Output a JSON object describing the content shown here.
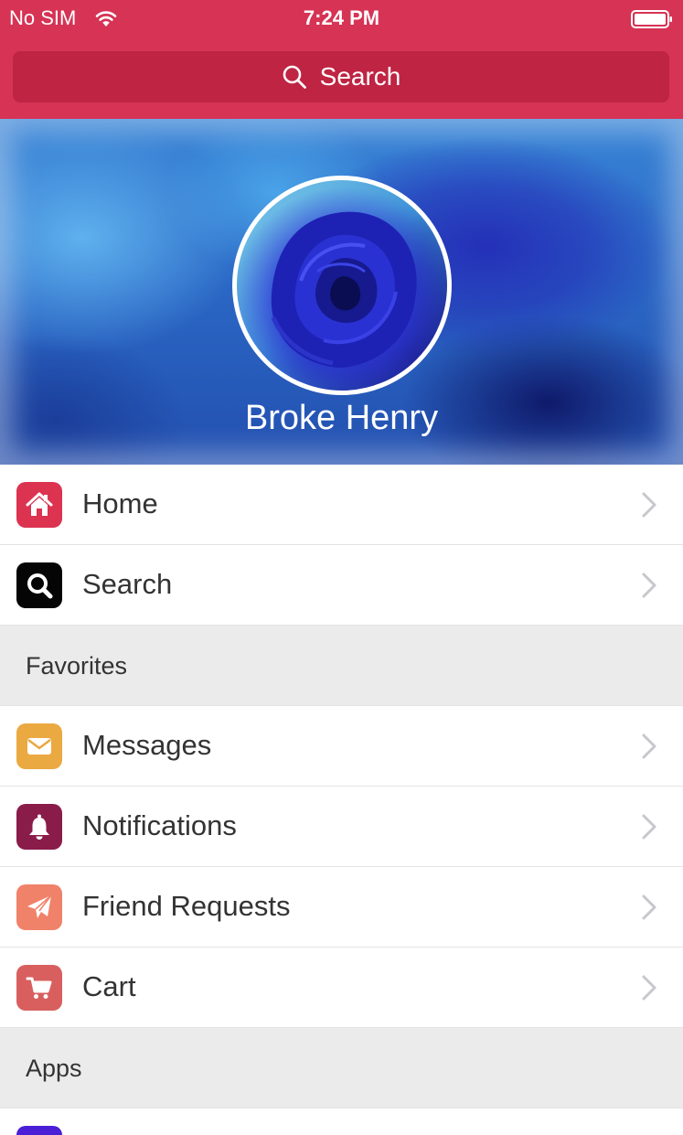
{
  "status_bar": {
    "carrier": "No SIM",
    "time": "7:24 PM"
  },
  "search": {
    "label": "Search"
  },
  "profile": {
    "name": "Broke Henry"
  },
  "menu": {
    "home": {
      "label": "Home",
      "icon": "home-icon",
      "color": "#dc3350"
    },
    "search": {
      "label": "Search",
      "icon": "search-icon",
      "color": "#050505"
    },
    "favorites_header": "Favorites",
    "messages": {
      "label": "Messages",
      "icon": "envelope-icon",
      "color": "#eba941"
    },
    "notifications": {
      "label": "Notifications",
      "icon": "bell-icon",
      "color": "#8a1c4a"
    },
    "friend_requests": {
      "label": "Friend Requests",
      "icon": "paper-plane-icon",
      "color": "#f0826a"
    },
    "cart": {
      "label": "Cart",
      "icon": "cart-icon",
      "color": "#d95f5f"
    },
    "apps_header": "Apps"
  },
  "colors": {
    "accent": "#d63355",
    "search_bar": "#bf2443",
    "section_bg": "#ebebeb"
  }
}
